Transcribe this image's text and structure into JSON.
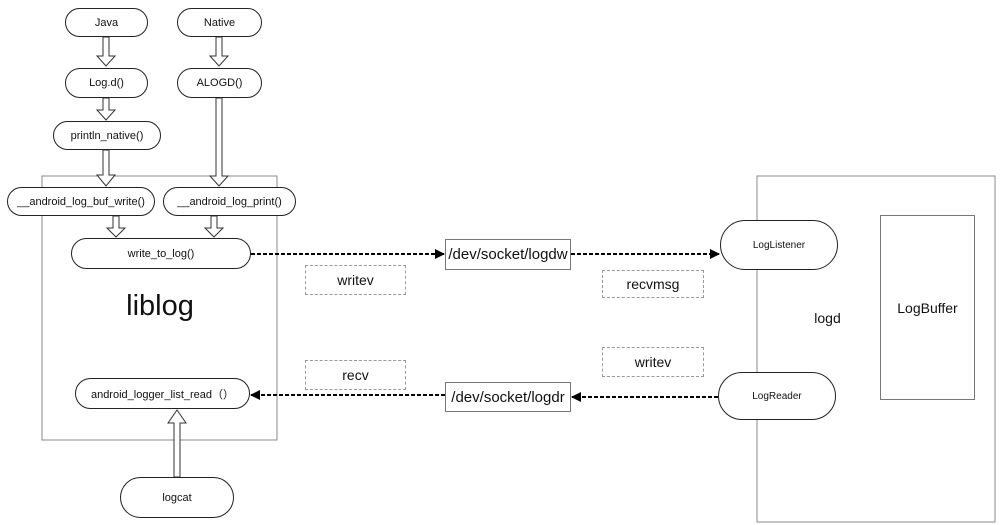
{
  "nodes": {
    "java": "Java",
    "native": "Native",
    "log_d": "Log.d()",
    "alogd": "ALOGD()",
    "println_native": "println_native()",
    "buf_write": "__android_log_buf_write()",
    "log_print": "__android_log_print()",
    "write_to_log": "write_to_log()",
    "list_read": "android_logger_list_read（）",
    "logcat": "logcat",
    "logdw": "/dev/socket/logdw",
    "logdr": "/dev/socket/logdr",
    "log_listener": "LogListener",
    "log_reader": "LogReader",
    "log_buffer": "LogBuffer"
  },
  "containers": {
    "liblog": "liblog",
    "logd": "logd"
  },
  "edge_labels": {
    "writev_1": "writev",
    "recvmsg": "recvmsg",
    "writev_2": "writev",
    "recv": "recv"
  }
}
